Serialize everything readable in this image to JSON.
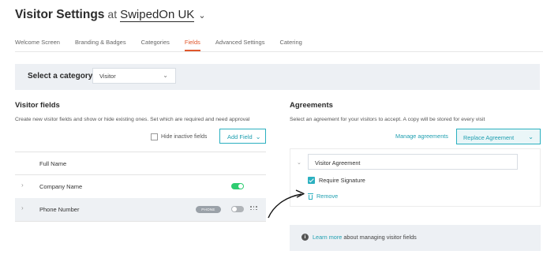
{
  "header": {
    "title": "Visitor Settings",
    "at": "at",
    "org": "SwipedOn UK",
    "org_chevron_icon": "chevron-down-icon"
  },
  "tabs": [
    {
      "label": "Welcome Screen",
      "active": false
    },
    {
      "label": "Branding & Badges",
      "active": false
    },
    {
      "label": "Categories",
      "active": false
    },
    {
      "label": "Fields",
      "active": true
    },
    {
      "label": "Advanced Settings",
      "active": false
    },
    {
      "label": "Catering",
      "active": false
    }
  ],
  "category": {
    "label": "Select a category",
    "selected": "Visitor"
  },
  "visitor_fields": {
    "title": "Visitor fields",
    "description": "Create new visitor fields and show or hide existing ones. Set which are required and need approval",
    "hide_inactive_label": "Hide inactive fields",
    "add_field_label": "Add Field",
    "rows": [
      {
        "name": "Full Name",
        "expandable": false,
        "toggle": null,
        "badge": null
      },
      {
        "name": "Company Name",
        "expandable": true,
        "toggle": "on",
        "badge": null
      },
      {
        "name": "Phone Number",
        "expandable": true,
        "toggle": "off",
        "badge": "PHONE"
      }
    ]
  },
  "agreements": {
    "title": "Agreements",
    "description": "Select an agreement for your visitors to accept. A copy will be stored for every visit",
    "manage_label": "Manage agreements",
    "replace_label": "Replace Agreement",
    "agreement_name": "Visitor Agreement",
    "require_signature_label": "Require Signature",
    "require_signature_checked": true,
    "remove_label": "Remove"
  },
  "info": {
    "link_text": "Learn more",
    "rest_text": " about managing visitor fields"
  },
  "colors": {
    "accent_orange": "#e0572c",
    "accent_teal": "#2bb0c0",
    "toggle_on": "#2ecc71",
    "toggle_off": "#b0b4b8"
  }
}
